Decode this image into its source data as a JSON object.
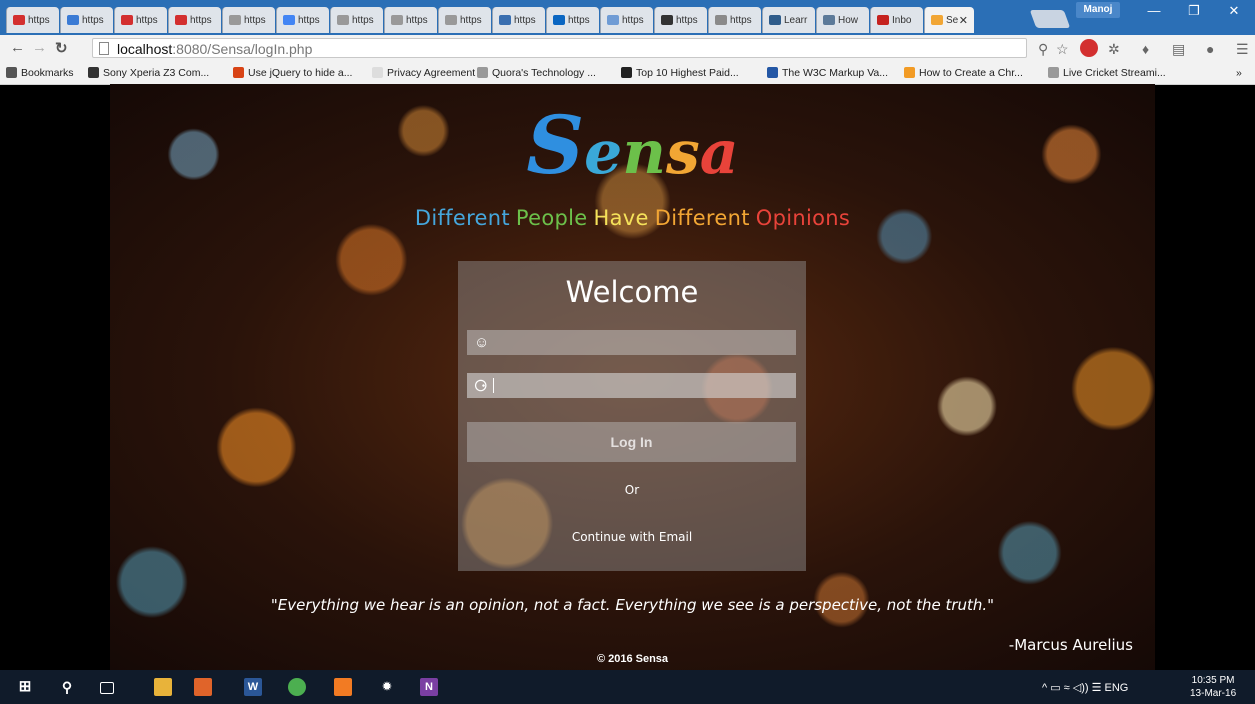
{
  "browser": {
    "tabs": [
      {
        "label": "https",
        "color": "#d32f2f"
      },
      {
        "label": "https",
        "color": "#3a7bd5"
      },
      {
        "label": "https",
        "color": "#d32f2f"
      },
      {
        "label": "https",
        "color": "#d32f2f"
      },
      {
        "label": "https",
        "color": "#999999"
      },
      {
        "label": "https",
        "color": "#4285f4"
      },
      {
        "label": "https",
        "color": "#999999"
      },
      {
        "label": "https",
        "color": "#999999"
      },
      {
        "label": "https",
        "color": "#999999"
      },
      {
        "label": "https",
        "color": "#3a6fb0"
      },
      {
        "label": "https",
        "color": "#0a66c2"
      },
      {
        "label": "https",
        "color": "#6f9cd5"
      },
      {
        "label": "https",
        "color": "#333333"
      },
      {
        "label": "https",
        "color": "#8a8a8a"
      },
      {
        "label": "Learr",
        "color": "#2f5c8a"
      },
      {
        "label": "How",
        "color": "#5c7a99"
      },
      {
        "label": "Inbo",
        "color": "#c5221f"
      },
      {
        "label": "Se",
        "color": "#f2a634",
        "active": true
      }
    ],
    "user": "Manoj",
    "window_buttons": {
      "minimize": "—",
      "restore": "❐",
      "close": "✕"
    },
    "tab_close": "✕",
    "url_host": "localhost",
    "url_path": ":8080/Sensa/logIn.php"
  },
  "bookmarks": [
    {
      "label": "Bookmarks",
      "color": "#555555"
    },
    {
      "label": "Sony Xperia Z3 Com...",
      "color": "#333333"
    },
    {
      "label": "Use jQuery to hide a...",
      "color": "#d84315"
    },
    {
      "label": "Privacy Agreement",
      "color": "#dddddd"
    },
    {
      "label": "Quora's Technology ...",
      "color": "#999999"
    },
    {
      "label": "Top 10 Highest Paid...",
      "color": "#222222"
    },
    {
      "label": "The W3C Markup Va...",
      "color": "#2457a5"
    },
    {
      "label": "How to Create a Chr...",
      "color": "#f29b25"
    },
    {
      "label": "Live Cricket Streami...",
      "color": "#999999"
    }
  ],
  "bookmarks_overflow": "»",
  "page": {
    "logo": {
      "l1": "S",
      "l2": "e",
      "l3": "n",
      "l4": "s",
      "l5": "a"
    },
    "tagline": [
      {
        "text": "Different",
        "color": "#45a6dc"
      },
      {
        "text": "People",
        "color": "#6cc04a"
      },
      {
        "text": "Have",
        "color": "#f5e25a"
      },
      {
        "text": "Different",
        "color": "#f2a634"
      },
      {
        "text": "Opinions",
        "color": "#e8433a"
      }
    ],
    "login": {
      "title": "Welcome",
      "username_placeholder": "",
      "password_placeholder": "",
      "login_label": "Log In",
      "or_label": "Or",
      "continue_label": "Continue with Email"
    },
    "quote": "\"Everything we hear is an opinion, not a fact. Everything we see is a perspective, not the truth.\"",
    "quote_author": "-Marcus Aurelius",
    "copyright": "© 2016 Sensa"
  },
  "taskbar": {
    "tray_text": "^ ▭ ≈ ◁)) ☰ ENG",
    "time": "10:35 PM",
    "date": "13-Mar-16"
  }
}
